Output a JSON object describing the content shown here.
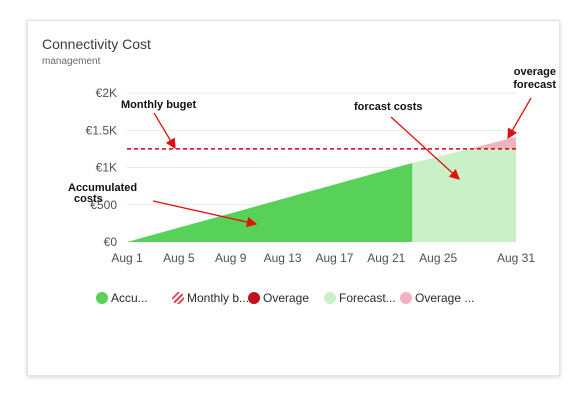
{
  "card": {
    "title": "Connectivity Cost",
    "subtitle": "management"
  },
  "chart_data": {
    "type": "area",
    "title": "Connectivity Cost",
    "subtitle": "management",
    "x_ticks": [
      "Aug 1",
      "Aug 5",
      "Aug 9",
      "Aug 13",
      "Aug 17",
      "Aug 21",
      "Aug 25",
      "Aug 31"
    ],
    "y_ticks": [
      "€0",
      "€500",
      "€1K",
      "€1.5K",
      "€2K"
    ],
    "ylim": [
      0,
      2000
    ],
    "xlim": [
      1,
      31
    ],
    "grid": true,
    "legend_position": "bottom",
    "series": [
      {
        "name": "Accu...",
        "kind": "area",
        "color": "#57d157",
        "x": [
          1,
          23
        ],
        "y": [
          0,
          1060
        ]
      },
      {
        "name": "Monthly b...",
        "kind": "dashed-line",
        "color": "#d0021b",
        "x": [
          1,
          31
        ],
        "y": [
          1250,
          1250
        ]
      },
      {
        "name": "Overage",
        "kind": "area",
        "color": "#c0111f",
        "x": [],
        "y": []
      },
      {
        "name": "Forecast...",
        "kind": "area",
        "color": "#c9f0c6",
        "x": [
          23,
          27.4,
          31
        ],
        "y": [
          1060,
          1250,
          1250
        ]
      },
      {
        "name": "Overage ...",
        "kind": "area",
        "color": "#f1b4bf",
        "x": [
          27.4,
          31
        ],
        "y_upper": [
          1250,
          1410
        ],
        "y_lower": [
          1250,
          1250
        ]
      }
    ],
    "annotations": [
      {
        "lines": [
          "Monthly buget"
        ]
      },
      {
        "lines": [
          "forcast costs"
        ]
      },
      {
        "lines": [
          "overage",
          "forecast"
        ]
      },
      {
        "lines": [
          "Accumulated",
          "costs"
        ]
      }
    ]
  },
  "legend": [
    {
      "label": "Accu...",
      "color": "#57d157",
      "style": "solid"
    },
    {
      "label": "Monthly b...",
      "color": "#d84a55",
      "style": "hatched"
    },
    {
      "label": "Overage",
      "color": "#c0111f",
      "style": "solid"
    },
    {
      "label": "Forecast...",
      "color": "#c9f0c6",
      "style": "solid"
    },
    {
      "label": "Overage ...",
      "color": "#f1b4bf",
      "style": "solid"
    }
  ]
}
